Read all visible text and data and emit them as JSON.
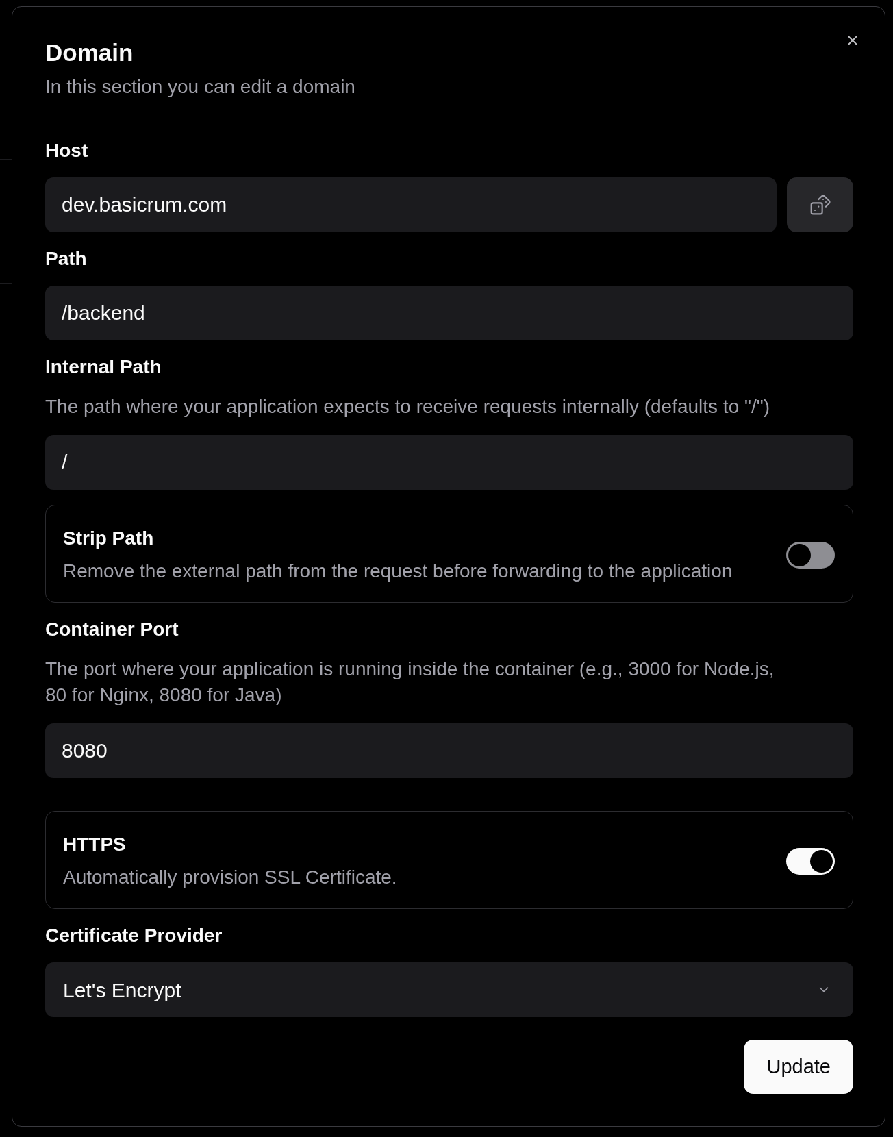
{
  "dialog": {
    "title": "Domain",
    "subtitle": "In this section you can edit a domain"
  },
  "sections": [
    {
      "fields": [
        {
          "kind": "input-with-action",
          "label": "Host",
          "value": "dev.basicrum.com"
        },
        {
          "kind": "input",
          "label": "Path",
          "value": "/backend"
        },
        {
          "kind": "input",
          "label": "Internal Path",
          "description": "The path where your application expects to receive requests internally (defaults to \"/\")",
          "value": "/"
        },
        {
          "kind": "toggle",
          "label": "Strip Path",
          "description": "Remove the external path from the request before forwarding to the application",
          "on": false
        },
        {
          "kind": "input",
          "label": "Container Port",
          "description": "The port where your application is running inside the container (e.g., 3000 for Node.js, 80 for Nginx, 8080 for Java)",
          "value": "8080"
        }
      ]
    },
    {
      "fields": [
        {
          "kind": "toggle",
          "label": "HTTPS",
          "description": "Automatically provision SSL Certificate.",
          "on": true
        },
        {
          "kind": "select",
          "label": "Certificate Provider",
          "value": "Let's Encrypt"
        }
      ]
    }
  ],
  "submit_button": "Update"
}
